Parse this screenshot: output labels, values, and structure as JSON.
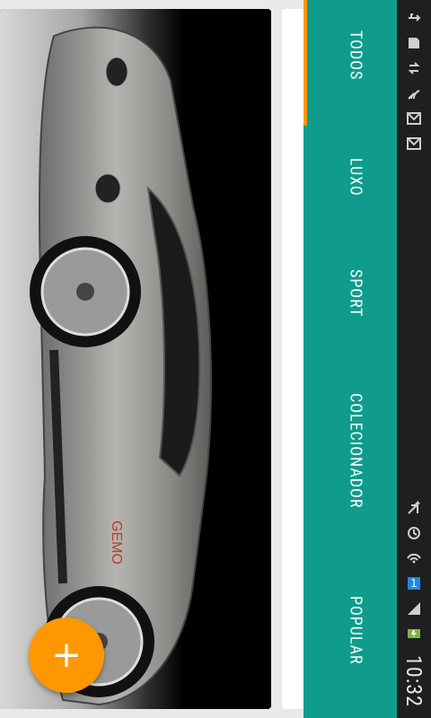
{
  "tabs": [
    {
      "label": "TODOS",
      "active": true
    },
    {
      "label": "LUXO"
    },
    {
      "label": "SPORT"
    },
    {
      "label": "COLECIONADOR"
    },
    {
      "label": "POPULAR"
    }
  ],
  "status_bar": {
    "time": "10:32",
    "sim_number": "1",
    "icons_top": [
      "usb-icon",
      "sd-card-icon",
      "sync-icon",
      "signal-broadcast-icon",
      "gmail-icon",
      "gmail-icon"
    ],
    "icons_bottom": [
      "mute-icon",
      "alarm-icon",
      "wifi-icon",
      "sim-icon",
      "cell-signal-icon",
      "battery-charging-icon"
    ]
  },
  "fab": {
    "label": "+"
  },
  "colors": {
    "accent": "#ff9800",
    "tabbar": "#0f9c8c",
    "statusbar": "#1f1f1f"
  },
  "card": {
    "image_subject": "silver-sports-car",
    "brand_text": "GEMO"
  }
}
